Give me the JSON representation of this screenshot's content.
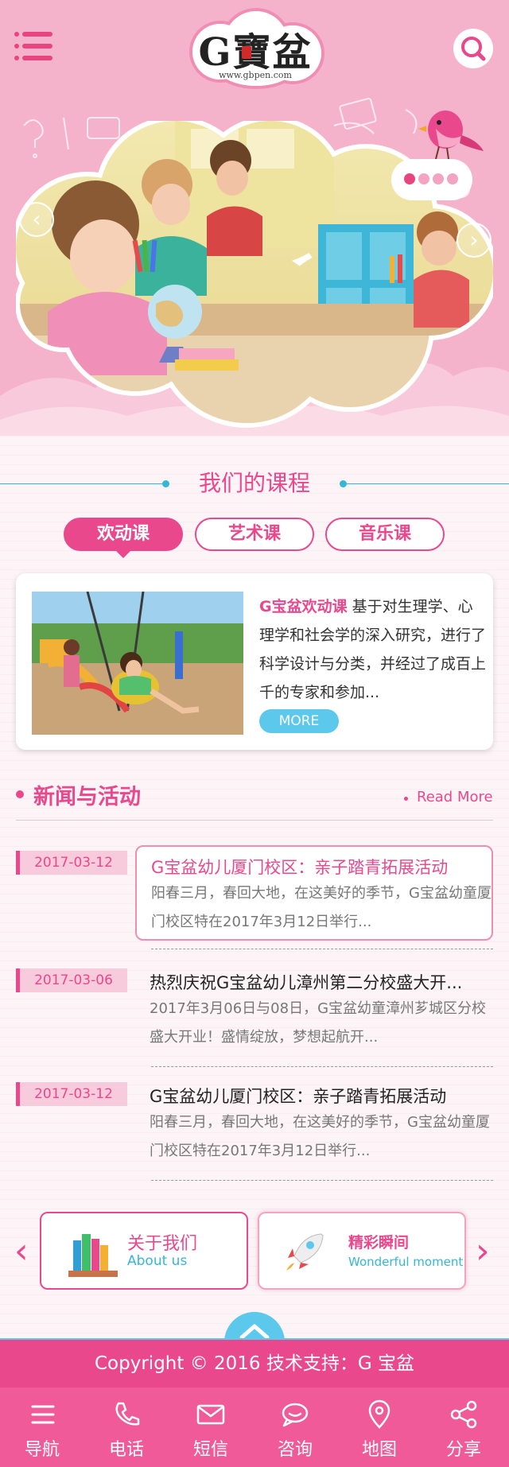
{
  "header": {
    "logo_text": "G寶盆",
    "logo_url": "www.gbpen.com",
    "menu_icon": "hamburger-icon",
    "search_icon": "search-icon"
  },
  "banner": {
    "prev_arrow": "‹",
    "next_arrow": "›",
    "slide_count": 4,
    "active_slide": 1
  },
  "courses": {
    "section_title": "我们的课程",
    "tabs": [
      {
        "label": "欢动课",
        "active": true
      },
      {
        "label": "艺术课",
        "active": false
      },
      {
        "label": "音乐课",
        "active": false
      }
    ],
    "card": {
      "highlight": "G宝盆欢动课",
      "body": " 基于对生理学、心理学和社会学的深入研究，进行了科学设计与分类，并经过了成百上千的专家和参加...",
      "more_label": "MORE"
    }
  },
  "news": {
    "title": "新闻与活动",
    "read_more": "Read More",
    "items": [
      {
        "date": "2017-03-12",
        "title": "G宝盆幼儿厦门校区：亲子踏青拓展活动",
        "summary": "阳春三月，春回大地，在这美好的季节，G宝盆幼童厦门校区特在2017年3月12日举行..."
      },
      {
        "date": "2017-03-06",
        "title": "热烈庆祝G宝盆幼儿漳州第二分校盛大开...",
        "summary": " 2017年3月06日与08日，G宝盆幼童漳州芗城区分校盛大开业！盛情绽放，梦想起航开..."
      },
      {
        "date": "2017-03-12",
        "title": "G宝盆幼儿厦门校区：亲子踏青拓展活动",
        "summary": "阳春三月，春回大地，在这美好的季节，G宝盆幼童厦门校区特在2017年3月12日举行..."
      }
    ]
  },
  "cards": {
    "prev_arrow": "‹",
    "next_arrow": "›",
    "about": {
      "title": "关于我们",
      "subtitle": "About us",
      "icon": "books-icon"
    },
    "moments": {
      "title": "精彩瞬间",
      "subtitle": "Wonderful moment",
      "icon": "rocket-icon"
    }
  },
  "footer": {
    "copyright": "Copyright © 2016  技术支持：G 宝盆",
    "nav": [
      {
        "label": "导航",
        "icon": "list-icon"
      },
      {
        "label": "电话",
        "icon": "phone-icon"
      },
      {
        "label": "短信",
        "icon": "mail-icon"
      },
      {
        "label": "咨询",
        "icon": "chat-icon"
      },
      {
        "label": "地图",
        "icon": "map-pin-icon"
      },
      {
        "label": "分享",
        "icon": "share-icon"
      }
    ]
  },
  "colors": {
    "brand_pink": "#e9488c",
    "header_pink": "#f5b3cb",
    "accent_blue": "#5cc8ec"
  }
}
